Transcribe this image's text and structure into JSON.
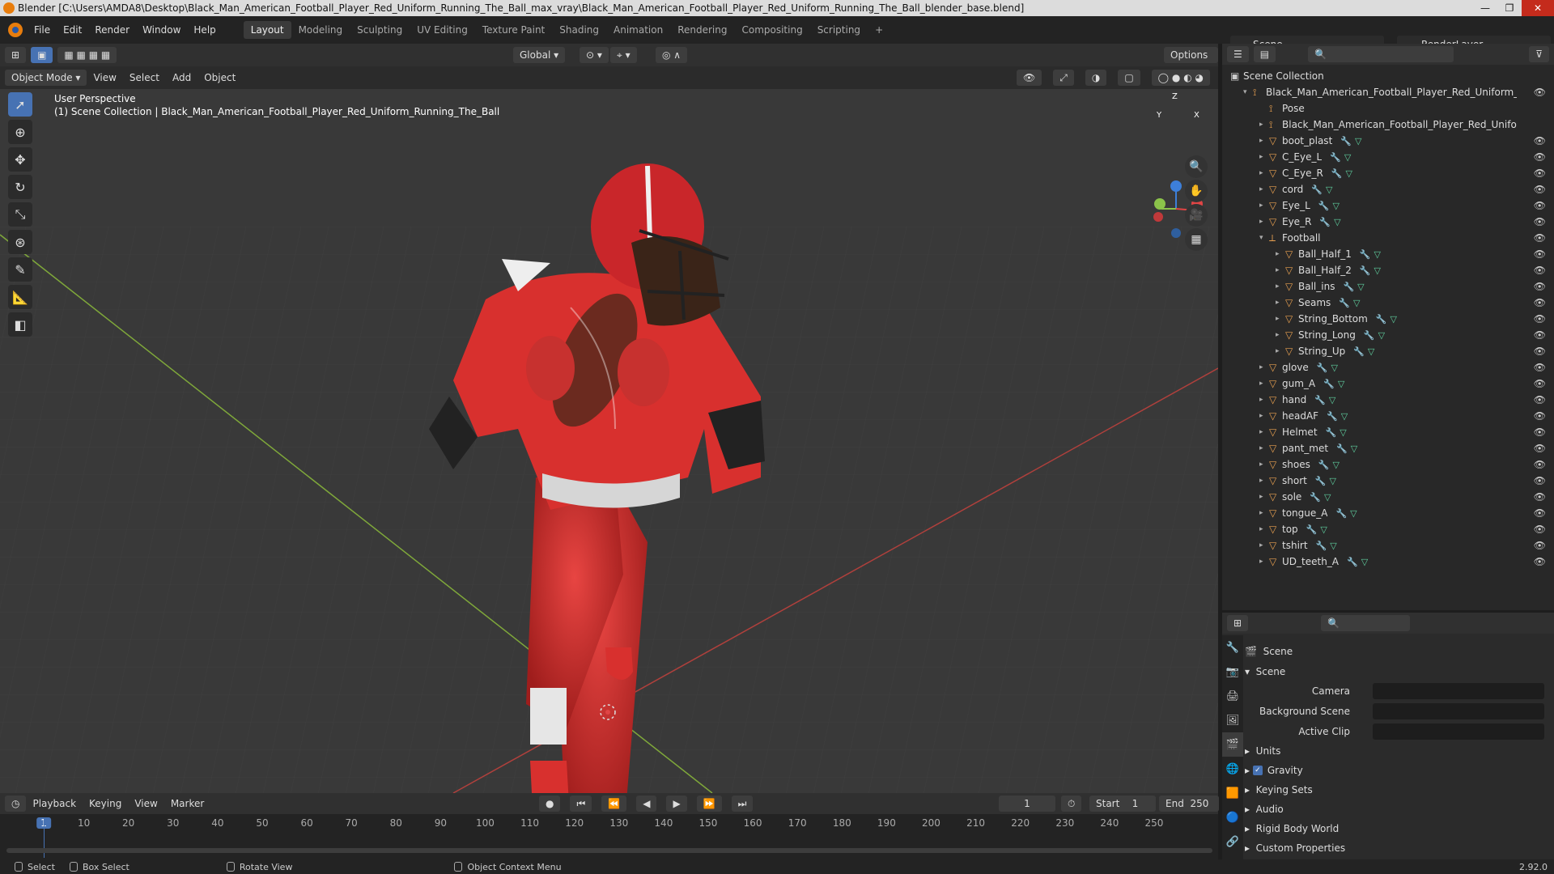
{
  "window": {
    "title": "Blender [C:\\Users\\AMDA8\\Desktop\\Black_Man_American_Football_Player_Red_Uniform_Running_The_Ball_max_vray\\Black_Man_American_Football_Player_Red_Uniform_Running_The_Ball_blender_base.blend]",
    "minimize": "—",
    "maximize": "❐",
    "close": "✕"
  },
  "menu": [
    "File",
    "Edit",
    "Render",
    "Window",
    "Help"
  ],
  "workspaces": [
    "Layout",
    "Modeling",
    "Sculpting",
    "UV Editing",
    "Texture Paint",
    "Shading",
    "Animation",
    "Rendering",
    "Compositing",
    "Scripting",
    "+"
  ],
  "active_workspace": "Layout",
  "scene_name": "Scene",
  "render_layer": "RenderLayer",
  "header": {
    "orientation": "Global",
    "options": "Options"
  },
  "viewport_header": {
    "mode": "Object Mode",
    "view": "View",
    "select": "Select",
    "add": "Add",
    "object": "Object"
  },
  "viewport": {
    "perspective": "User Perspective",
    "collection": "(1) Scene Collection | Black_Man_American_Football_Player_Red_Uniform_Running_The_Ball"
  },
  "gizmo": {
    "x": "X",
    "y": "Y",
    "z": "Z"
  },
  "outliner": {
    "root": "Scene Collection",
    "rows": [
      {
        "label": "Black_Man_American_Football_Player_Red_Uniform_Running_The_Ball",
        "depth": 1,
        "icon": "armature",
        "exp": "▾",
        "eye": true,
        "mod": false
      },
      {
        "label": "Pose",
        "depth": 2,
        "icon": "pose",
        "exp": "",
        "eye": false,
        "mod": false
      },
      {
        "label": "Black_Man_American_Football_Player_Red_Uniform_Running_The_Ball",
        "depth": 2,
        "icon": "armature",
        "exp": "▸",
        "eye": false,
        "mod": false
      },
      {
        "label": "boot_plast",
        "depth": 2,
        "icon": "mesh",
        "exp": "▸",
        "eye": true,
        "mod": true
      },
      {
        "label": "C_Eye_L",
        "depth": 2,
        "icon": "mesh",
        "exp": "▸",
        "eye": true,
        "mod": true
      },
      {
        "label": "C_Eye_R",
        "depth": 2,
        "icon": "mesh",
        "exp": "▸",
        "eye": true,
        "mod": true
      },
      {
        "label": "cord",
        "depth": 2,
        "icon": "mesh",
        "exp": "▸",
        "eye": true,
        "mod": true
      },
      {
        "label": "Eye_L",
        "depth": 2,
        "icon": "mesh",
        "exp": "▸",
        "eye": true,
        "mod": true
      },
      {
        "label": "Eye_R",
        "depth": 2,
        "icon": "mesh",
        "exp": "▸",
        "eye": true,
        "mod": true
      },
      {
        "label": "Football",
        "depth": 2,
        "icon": "empty",
        "exp": "▾",
        "eye": true,
        "mod": false
      },
      {
        "label": "Ball_Half_1",
        "depth": 3,
        "icon": "mesh",
        "exp": "▸",
        "eye": true,
        "mod": true
      },
      {
        "label": "Ball_Half_2",
        "depth": 3,
        "icon": "mesh",
        "exp": "▸",
        "eye": true,
        "mod": true
      },
      {
        "label": "Ball_ins",
        "depth": 3,
        "icon": "mesh",
        "exp": "▸",
        "eye": true,
        "mod": true
      },
      {
        "label": "Seams",
        "depth": 3,
        "icon": "mesh",
        "exp": "▸",
        "eye": true,
        "mod": true
      },
      {
        "label": "String_Bottom",
        "depth": 3,
        "icon": "mesh",
        "exp": "▸",
        "eye": true,
        "mod": true
      },
      {
        "label": "String_Long",
        "depth": 3,
        "icon": "mesh",
        "exp": "▸",
        "eye": true,
        "mod": true
      },
      {
        "label": "String_Up",
        "depth": 3,
        "icon": "mesh",
        "exp": "▸",
        "eye": true,
        "mod": true
      },
      {
        "label": "glove",
        "depth": 2,
        "icon": "mesh",
        "exp": "▸",
        "eye": true,
        "mod": true
      },
      {
        "label": "gum_A",
        "depth": 2,
        "icon": "mesh",
        "exp": "▸",
        "eye": true,
        "mod": true
      },
      {
        "label": "hand",
        "depth": 2,
        "icon": "mesh",
        "exp": "▸",
        "eye": true,
        "mod": true
      },
      {
        "label": "headAF",
        "depth": 2,
        "icon": "mesh",
        "exp": "▸",
        "eye": true,
        "mod": true
      },
      {
        "label": "Helmet",
        "depth": 2,
        "icon": "mesh",
        "exp": "▸",
        "eye": true,
        "mod": true
      },
      {
        "label": "pant_met",
        "depth": 2,
        "icon": "mesh",
        "exp": "▸",
        "eye": true,
        "mod": true
      },
      {
        "label": "shoes",
        "depth": 2,
        "icon": "mesh",
        "exp": "▸",
        "eye": true,
        "mod": true
      },
      {
        "label": "short",
        "depth": 2,
        "icon": "mesh",
        "exp": "▸",
        "eye": true,
        "mod": true
      },
      {
        "label": "sole",
        "depth": 2,
        "icon": "mesh",
        "exp": "▸",
        "eye": true,
        "mod": true
      },
      {
        "label": "tongue_A",
        "depth": 2,
        "icon": "mesh",
        "exp": "▸",
        "eye": true,
        "mod": true
      },
      {
        "label": "top",
        "depth": 2,
        "icon": "mesh",
        "exp": "▸",
        "eye": true,
        "mod": true
      },
      {
        "label": "tshirt",
        "depth": 2,
        "icon": "mesh",
        "exp": "▸",
        "eye": true,
        "mod": true
      },
      {
        "label": "UD_teeth_A",
        "depth": 2,
        "icon": "mesh",
        "exp": "▸",
        "eye": true,
        "mod": true
      }
    ]
  },
  "properties": {
    "context": "Scene",
    "section": "Scene",
    "camera_label": "Camera",
    "bg_scene_label": "Background Scene",
    "active_clip_label": "Active Clip",
    "panels": [
      "Units",
      "Gravity",
      "Keying Sets",
      "Audio",
      "Rigid Body World",
      "Custom Properties"
    ],
    "gravity_checked": true
  },
  "timeline": {
    "playback": "Playback",
    "keying": "Keying",
    "view": "View",
    "marker": "Marker",
    "current_frame": "1",
    "start_label": "Start",
    "start": "1",
    "end_label": "End",
    "end": "250",
    "ticks": [
      "1",
      "10",
      "20",
      "30",
      "40",
      "50",
      "60",
      "70",
      "80",
      "90",
      "100",
      "110",
      "120",
      "130",
      "140",
      "150",
      "160",
      "170",
      "180",
      "190",
      "200",
      "210",
      "220",
      "230",
      "240",
      "250"
    ]
  },
  "statusbar": {
    "select": "Select",
    "box_select": "Box Select",
    "rotate": "Rotate View",
    "context_menu": "Object Context Menu",
    "version": "2.92.0"
  },
  "colors": {
    "accent": "#4772b3",
    "uniform": "#d8302e",
    "x_axis": "#e04545",
    "y_axis": "#8bc34a",
    "z_axis": "#3d7fd9"
  }
}
